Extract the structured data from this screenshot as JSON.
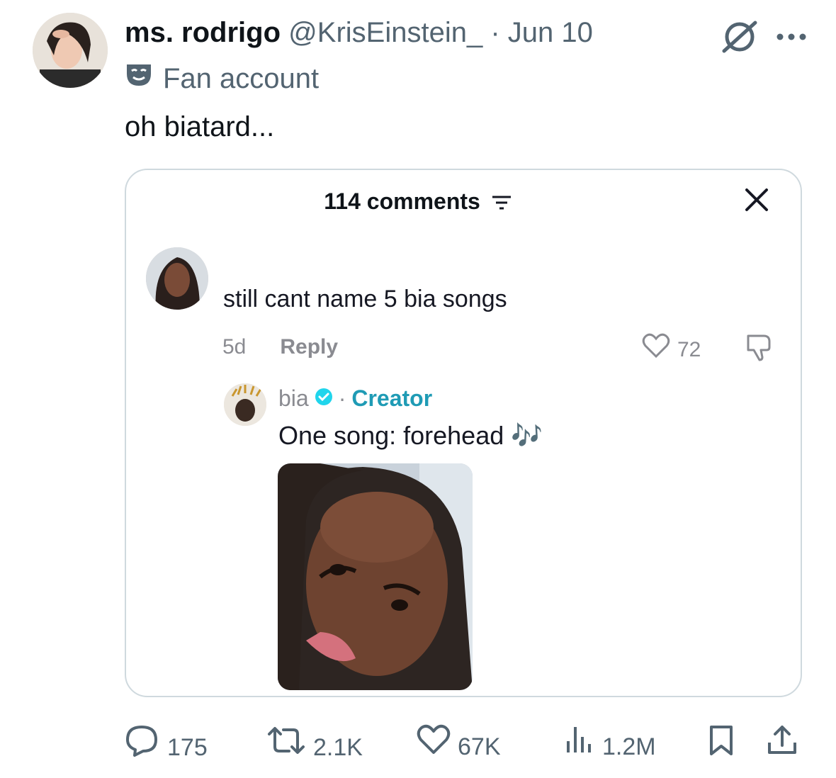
{
  "tweet": {
    "display_name": "ms. rodrigo",
    "handle": "@KrisEinstein_",
    "separator": "·",
    "date": "Jun 10",
    "label": "Fan account",
    "text": "oh biatard..."
  },
  "embedded": {
    "comments_count": "114 comments",
    "comment": {
      "text": "still cant name 5 bia songs",
      "age": "5d",
      "reply_label": "Reply",
      "likes": "72"
    },
    "reply": {
      "name": "bia",
      "separator": "·",
      "role": "Creator",
      "text": "One song: forehead",
      "emoji": "🎶"
    }
  },
  "actions": {
    "replies": "175",
    "reposts": "2.1K",
    "likes": "67K",
    "views": "1.2M"
  },
  "colors": {
    "text": "#0f1419",
    "secondary": "#536471",
    "creator": "#1f9bb5",
    "verified": "#20d5ec",
    "border": "#cfd9de"
  },
  "icons": [
    "grok-icon",
    "more-icon",
    "fan-mask-icon",
    "filter-icon",
    "close-icon",
    "heart-icon",
    "dislike-icon",
    "verified-icon",
    "reply-icon",
    "repost-icon",
    "like-icon",
    "views-icon",
    "bookmark-icon",
    "share-icon"
  ]
}
